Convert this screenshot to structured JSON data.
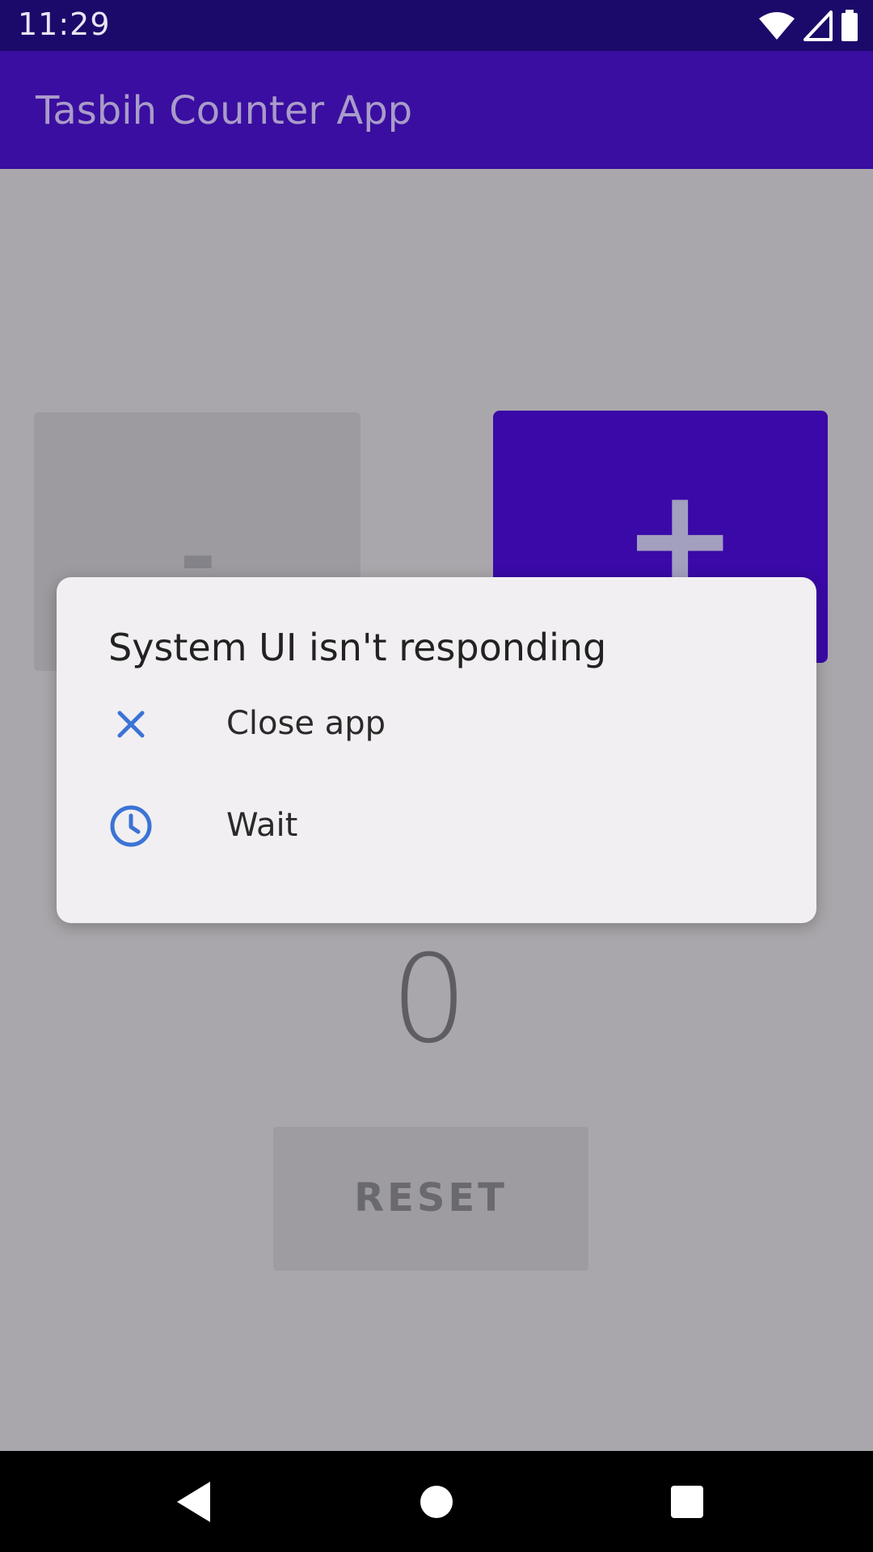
{
  "status_bar": {
    "time": "11:29",
    "icons": [
      "wifi-icon",
      "signal-icon",
      "battery-icon"
    ]
  },
  "app_bar": {
    "title": "Tasbih Counter App"
  },
  "counter": {
    "decrement_label": "-",
    "increment_label": "+",
    "value": "0",
    "reset_label": "RESET"
  },
  "dialog": {
    "title": "System UI isn't responding",
    "options": [
      {
        "label": "Close app",
        "icon": "close-icon"
      },
      {
        "label": "Wait",
        "icon": "clock-icon"
      }
    ]
  },
  "nav_bar": {
    "buttons": [
      "back-icon",
      "home-icon",
      "recents-icon"
    ]
  },
  "colors": {
    "status_bar": "#1c0a6b",
    "app_bar": "#3a0ea0",
    "accent": "#3a09a8",
    "dialog_icon": "#3b73d6",
    "scrim_background": "#a9a7ab"
  }
}
